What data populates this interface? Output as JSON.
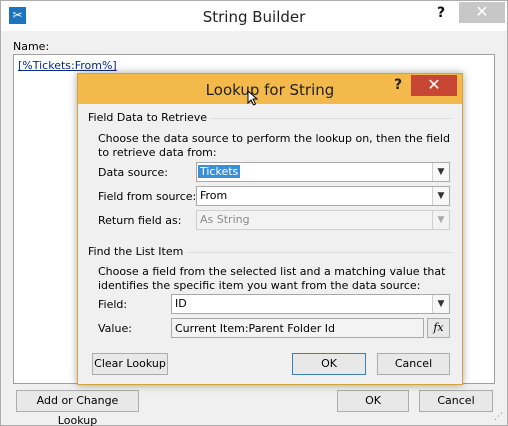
{
  "outer_window": {
    "title": "String Builder",
    "help_glyph": "?",
    "close_glyph": "✕",
    "name_label": "Name:",
    "name_value": "[%Tickets:From%]",
    "add_change_lookup_label": "Add or Change Lookup",
    "ok_label": "OK",
    "cancel_label": "Cancel"
  },
  "lookup_dialog": {
    "title": "Lookup for String",
    "help_glyph": "?",
    "close_glyph": "✕",
    "field_data_group": {
      "title": "Field Data to Retrieve",
      "description": "Choose the data source to perform the lookup on, then the field to retrieve data from:",
      "data_source_label": "Data source:",
      "data_source_value": "Tickets",
      "field_from_source_label": "Field from source:",
      "field_from_source_value": "From",
      "return_field_label": "Return field as:",
      "return_field_value": "As String"
    },
    "list_item_group": {
      "title": "Find the List Item",
      "description": "Choose a field from the selected list and a matching value that identifies the specific item you want from the data source:",
      "field_label": "Field:",
      "field_value": "ID",
      "value_label": "Value:",
      "value_value": "Current Item:Parent Folder Id",
      "fx_label": "fx"
    },
    "clear_lookup_label": "Clear Lookup",
    "ok_label": "OK",
    "cancel_label": "Cancel"
  },
  "colors": {
    "dialog_titlebar": "#f3b94a",
    "dialog_close": "#c74634",
    "selection": "#3b8fd6"
  },
  "icons": {
    "app_icon": "tools-icon",
    "dropdown_arrow": "chevron-down-icon",
    "cursor": "mouse-pointer-icon"
  }
}
